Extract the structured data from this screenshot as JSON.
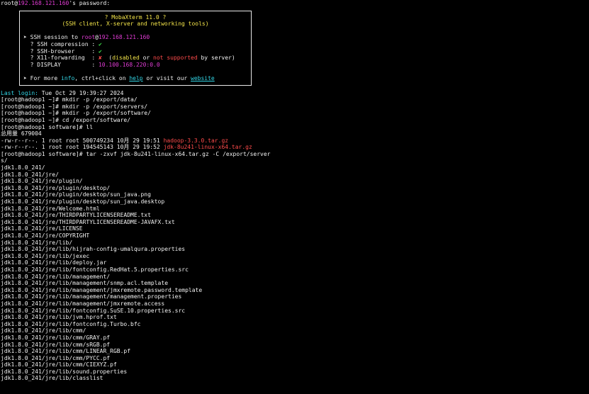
{
  "prompt": {
    "user": "root",
    "at": "@",
    "host": "192.168.121.160",
    "suffix": "'s password:"
  },
  "banner": {
    "title": "? MobaXterm 11.0 ?",
    "subtitle": "(SSH client, X-server and networking tools)",
    "session_arrow": "➤",
    "session_label": " SSH session to ",
    "session_user": "root",
    "session_at": "@",
    "session_host": "192.168.121.160",
    "compression_label": "? SSH compression : ",
    "compression_value": "✔",
    "browser_label": "? SSH-browser     : ",
    "browser_value": "✔",
    "x11_label": "? X11-forwarding  : ",
    "x11_value": "✘",
    "x11_open": "  (",
    "x11_disabled": "disabled",
    "x11_or": " or ",
    "x11_not_supported": "not supported",
    "x11_close": " by server)",
    "display_label": "? DISPLAY         : ",
    "display_value": "10.100.168.220:0.0",
    "more_arrow": "➤",
    "more_prefix": " For more ",
    "more_info": "info",
    "more_mid": ", ctrl+click on ",
    "more_help": "help",
    "more_or": " or visit our ",
    "more_website": "website"
  },
  "last_login": {
    "label": "Last login:",
    "value": " Tue Oct 29 19:39:27 2024"
  },
  "commands": [
    "[root@hadoop1 ~]# mkdir -p /export/data/",
    "[root@hadoop1 ~]# mkdir -p /export/servers/",
    "[root@hadoop1 ~]# mkdir -p /export/software/",
    "[root@hadoop1 ~]# cd /export/software/",
    "[root@hadoop1 software]# ll",
    "总用量 679004"
  ],
  "listing": [
    {
      "meta": "-rw-r--r--. 1 root root 500749234 10月 29 19:51 ",
      "name": "hadoop-3.3.0.tar.gz"
    },
    {
      "meta": "-rw-r--r--. 1 root root 194545143 10月 29 19:52 ",
      "name": "jdk-8u241-linux-x64.tar.gz"
    }
  ],
  "tar_command": "[root@hadoop1 software]# tar -zxvf jdk-8u241-linux-x64.tar.gz -C /export/server",
  "tar_wrap": "s/",
  "output": [
    "jdk1.8.0_241/",
    "jdk1.8.0_241/jre/",
    "jdk1.8.0_241/jre/plugin/",
    "jdk1.8.0_241/jre/plugin/desktop/",
    "jdk1.8.0_241/jre/plugin/desktop/sun_java.png",
    "jdk1.8.0_241/jre/plugin/desktop/sun_java.desktop",
    "jdk1.8.0_241/jre/Welcome.html",
    "jdk1.8.0_241/jre/THIRDPARTYLICENSEREADME.txt",
    "jdk1.8.0_241/jre/THIRDPARTYLICENSEREADME-JAVAFX.txt",
    "jdk1.8.0_241/jre/LICENSE",
    "jdk1.8.0_241/jre/COPYRIGHT",
    "jdk1.8.0_241/jre/lib/",
    "jdk1.8.0_241/jre/lib/hijrah-config-umalqura.properties",
    "jdk1.8.0_241/jre/lib/jexec",
    "jdk1.8.0_241/jre/lib/deploy.jar",
    "jdk1.8.0_241/jre/lib/fontconfig.RedHat.5.properties.src",
    "jdk1.8.0_241/jre/lib/management/",
    "jdk1.8.0_241/jre/lib/management/snmp.acl.template",
    "jdk1.8.0_241/jre/lib/management/jmxremote.password.template",
    "jdk1.8.0_241/jre/lib/management/management.properties",
    "jdk1.8.0_241/jre/lib/management/jmxremote.access",
    "jdk1.8.0_241/jre/lib/fontconfig.SuSE.10.properties.src",
    "jdk1.8.0_241/jre/lib/jvm.hprof.txt",
    "jdk1.8.0_241/jre/lib/fontconfig.Turbo.bfc",
    "jdk1.8.0_241/jre/lib/cmm/",
    "jdk1.8.0_241/jre/lib/cmm/GRAY.pf",
    "jdk1.8.0_241/jre/lib/cmm/sRGB.pf",
    "jdk1.8.0_241/jre/lib/cmm/LINEAR_RGB.pf",
    "jdk1.8.0_241/jre/lib/cmm/PYCC.pf",
    "jdk1.8.0_241/jre/lib/cmm/CIEXYZ.pf",
    "jdk1.8.0_241/jre/lib/sound.properties",
    "jdk1.8.0_241/jre/lib/classlist"
  ],
  "colors": {
    "background": "#000000",
    "foreground": "#f2f2f2",
    "yellow": "#f5e64a",
    "magenta": "#e23cd6",
    "green": "#3ddc4a",
    "red": "#ff4b4b",
    "cyan": "#33d6e6"
  }
}
